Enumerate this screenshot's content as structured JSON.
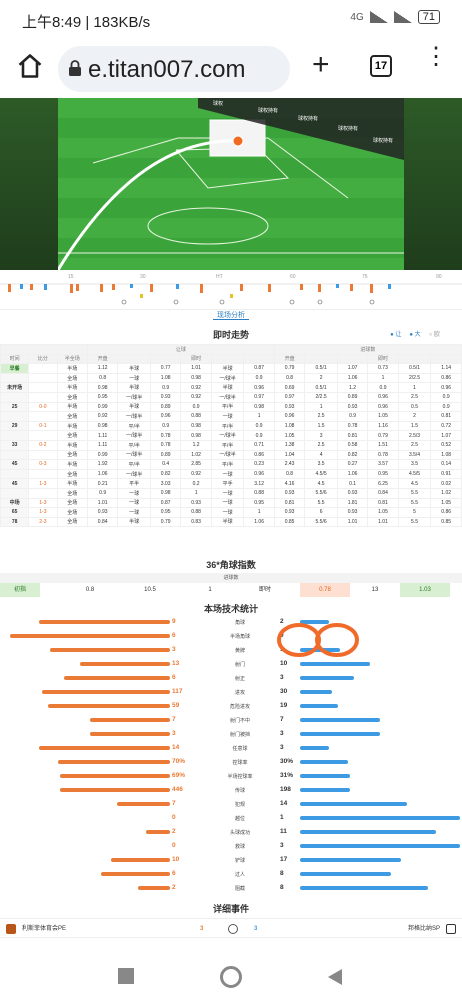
{
  "status_bar": {
    "time_speed": "上午8:49 | 183KB/s",
    "signal_label": "4G",
    "battery": "71"
  },
  "browser": {
    "url": "e.titan007.com",
    "tab_count": "17"
  },
  "pitch": {
    "tags": [
      "球权",
      "球权持有",
      "球权持有",
      "球权持有",
      "球权持有"
    ]
  },
  "timeline": {
    "ticks": [
      "15",
      "30",
      "HT",
      "60",
      "75",
      "90"
    ]
  },
  "nav_tab": "现场分析",
  "odds": {
    "title": "即时走势",
    "options": [
      "让",
      "大",
      "欧"
    ],
    "group_left": "让球",
    "group_right": "进球数",
    "headers": [
      "时间",
      "比分",
      "半全场",
      "开盘",
      "",
      "",
      "即时",
      "",
      "",
      "开盘",
      "",
      "",
      "即时",
      "",
      ""
    ],
    "rows": [
      [
        "早餐",
        "",
        "半场",
        "1.12",
        "半球",
        "0.77",
        "1.01",
        "半球",
        "0.87",
        "0.79",
        "0.5/1",
        "1.07",
        "0.73",
        "0.5/1",
        "1.14"
      ],
      [
        "",
        "",
        "全场",
        "0.8",
        "一球",
        "1.08",
        "0.98",
        "一/球半",
        "0.9",
        "0.8",
        "2",
        "1.06",
        "1",
        "2/2.5",
        "0.86"
      ],
      [
        "未开场",
        "",
        "半场",
        "0.98",
        "半球",
        "0.9",
        "0.92",
        "半球",
        "0.96",
        "0.69",
        "0.5/1",
        "1.2",
        "0.9",
        "1",
        "0.96"
      ],
      [
        "",
        "",
        "全场",
        "0.95",
        "一/球半",
        "0.93",
        "0.92",
        "一/球半",
        "0.97",
        "0.97",
        "2/2.5",
        "0.89",
        "0.96",
        "2.5",
        "0.9"
      ],
      [
        "25",
        "0-0",
        "半场",
        "0.99",
        "半球",
        "0.89",
        "0.9",
        "平/半",
        "0.98",
        "0.93",
        "1",
        "0.93",
        "0.96",
        "0.5",
        "0.9"
      ],
      [
        "",
        "",
        "全场",
        "0.92",
        "一/球半",
        "0.96",
        "0.88",
        "一球",
        "1",
        "0.96",
        "2.5",
        "0.9",
        "1.05",
        "2",
        "0.81"
      ],
      [
        "29",
        "0-1",
        "半场",
        "0.98",
        "平/半",
        "0.9",
        "0.98",
        "平/半",
        "0.9",
        "1.08",
        "1.5",
        "0.78",
        "1.16",
        "1.5",
        "0.72"
      ],
      [
        "",
        "",
        "全场",
        "1.11",
        "一/球半",
        "0.78",
        "0.98",
        "一/球半",
        "0.9",
        "1.05",
        "3",
        "0.81",
        "0.79",
        "2.5/3",
        "1.07"
      ],
      [
        "33",
        "0-2",
        "半场",
        "1.11",
        "平/半",
        "0.78",
        "1.2",
        "平/半",
        "0.71",
        "1.38",
        "2.5",
        "0.58",
        "1.51",
        "2.5",
        "0.52"
      ],
      [
        "",
        "",
        "全场",
        "0.99",
        "一/球半",
        "0.89",
        "1.02",
        "一/球半",
        "0.86",
        "1.04",
        "4",
        "0.82",
        "0.78",
        "3.5/4",
        "1.08"
      ],
      [
        "45",
        "0-3",
        "半场",
        "1.92",
        "平/半",
        "0.4",
        "2.85",
        "平/半",
        "0.23",
        "2.43",
        "3.5",
        "0.27",
        "3.57",
        "3.5",
        "0.14"
      ],
      [
        "",
        "",
        "全场",
        "1.06",
        "一/球半",
        "0.82",
        "0.92",
        "一球",
        "0.96",
        "0.8",
        "4.5/5",
        "1.06",
        "0.95",
        "4.5/5",
        "0.91"
      ],
      [
        "45",
        "1-3",
        "半场",
        "0.21",
        "平半",
        "3.03",
        "0.2",
        "平手",
        "3.12",
        "4.16",
        "4.5",
        "0.1",
        "6.25",
        "4.5",
        "0.02"
      ],
      [
        "",
        "",
        "全场",
        "0.9",
        "一球",
        "0.98",
        "1",
        "一球",
        "0.88",
        "0.93",
        "5.5/6",
        "0.93",
        "0.84",
        "5.5",
        "1.02"
      ],
      [
        "中场",
        "1-3",
        "全场",
        "1.01",
        "一球",
        "0.87",
        "0.93",
        "一球",
        "0.95",
        "0.81",
        "5.5",
        "1.81",
        "0.81",
        "5.5",
        "1.05"
      ],
      [
        "65",
        "1-3",
        "全场",
        "0.93",
        "一球",
        "0.95",
        "0.88",
        "一球",
        "1",
        "0.93",
        "6",
        "0.93",
        "1.05",
        "5",
        "0.86"
      ],
      [
        "78",
        "2-3",
        "全场",
        "0.84",
        "半球",
        "0.79",
        "0.83",
        "半球",
        "1.06",
        "0.85",
        "5.5/6",
        "1.01",
        "1.01",
        "5.5",
        "0.85"
      ]
    ]
  },
  "corner_index": {
    "title": "36*角球指数",
    "subheader": "进球数",
    "row1": [
      "初指",
      "0.8",
      "10.5",
      "1",
      "即时",
      "0.78",
      "13",
      "1.03"
    ]
  },
  "tech_stats": {
    "title": "本场技术统计",
    "items": [
      {
        "label": "角球",
        "left": "9",
        "right": "2",
        "lfrac": 0.82,
        "rfrac": 0.18
      },
      {
        "label": "半场角球",
        "left": "6",
        "right": "0",
        "lfrac": 1.0,
        "rfrac": 0.0
      },
      {
        "label": "黄牌",
        "left": "3",
        "right": "1",
        "lfrac": 0.75,
        "rfrac": 0.25
      },
      {
        "label": "射门",
        "left": "13",
        "right": "10",
        "lfrac": 0.56,
        "rfrac": 0.44
      },
      {
        "label": "射正",
        "left": "6",
        "right": "3",
        "lfrac": 0.66,
        "rfrac": 0.34
      },
      {
        "label": "进攻",
        "left": "117",
        "right": "30",
        "lfrac": 0.8,
        "rfrac": 0.2
      },
      {
        "label": "危险进攻",
        "left": "59",
        "right": "19",
        "lfrac": 0.76,
        "rfrac": 0.24
      },
      {
        "label": "射门不中",
        "left": "7",
        "right": "7",
        "lfrac": 0.5,
        "rfrac": 0.5
      },
      {
        "label": "射门被挡",
        "left": "3",
        "right": "3",
        "lfrac": 0.5,
        "rfrac": 0.5
      },
      {
        "label": "任意球",
        "left": "14",
        "right": "3",
        "lfrac": 0.82,
        "rfrac": 0.18
      },
      {
        "label": "控球率",
        "left": "70%",
        "right": "30%",
        "lfrac": 0.7,
        "rfrac": 0.3
      },
      {
        "label": "半场控球率",
        "left": "69%",
        "right": "31%",
        "lfrac": 0.69,
        "rfrac": 0.31
      },
      {
        "label": "传球",
        "left": "446",
        "right": "198",
        "lfrac": 0.69,
        "rfrac": 0.31
      },
      {
        "label": "犯规",
        "left": "7",
        "right": "14",
        "lfrac": 0.33,
        "rfrac": 0.67
      },
      {
        "label": "越位",
        "left": "0",
        "right": "1",
        "lfrac": 0.0,
        "rfrac": 1.0
      },
      {
        "label": "头球成功",
        "left": "2",
        "right": "11",
        "lfrac": 0.15,
        "rfrac": 0.85
      },
      {
        "label": "救球",
        "left": "0",
        "right": "3",
        "lfrac": 0.0,
        "rfrac": 1.0
      },
      {
        "label": "铲球",
        "left": "10",
        "right": "17",
        "lfrac": 0.37,
        "rfrac": 0.63
      },
      {
        "label": "过人",
        "left": "6",
        "right": "8",
        "lfrac": 0.43,
        "rfrac": 0.57
      },
      {
        "label": "阻截",
        "left": "2",
        "right": "8",
        "lfrac": 0.2,
        "rfrac": 0.8
      }
    ]
  },
  "events": {
    "title": "详细事件",
    "home_team": "利斯菲体育会PE",
    "away_team": "邦格比纳SP",
    "home_score": "3",
    "away_score": "3"
  },
  "colors": {
    "home": "#ea7a36",
    "away": "#3d9be3",
    "accent": "#2a7fc4"
  }
}
